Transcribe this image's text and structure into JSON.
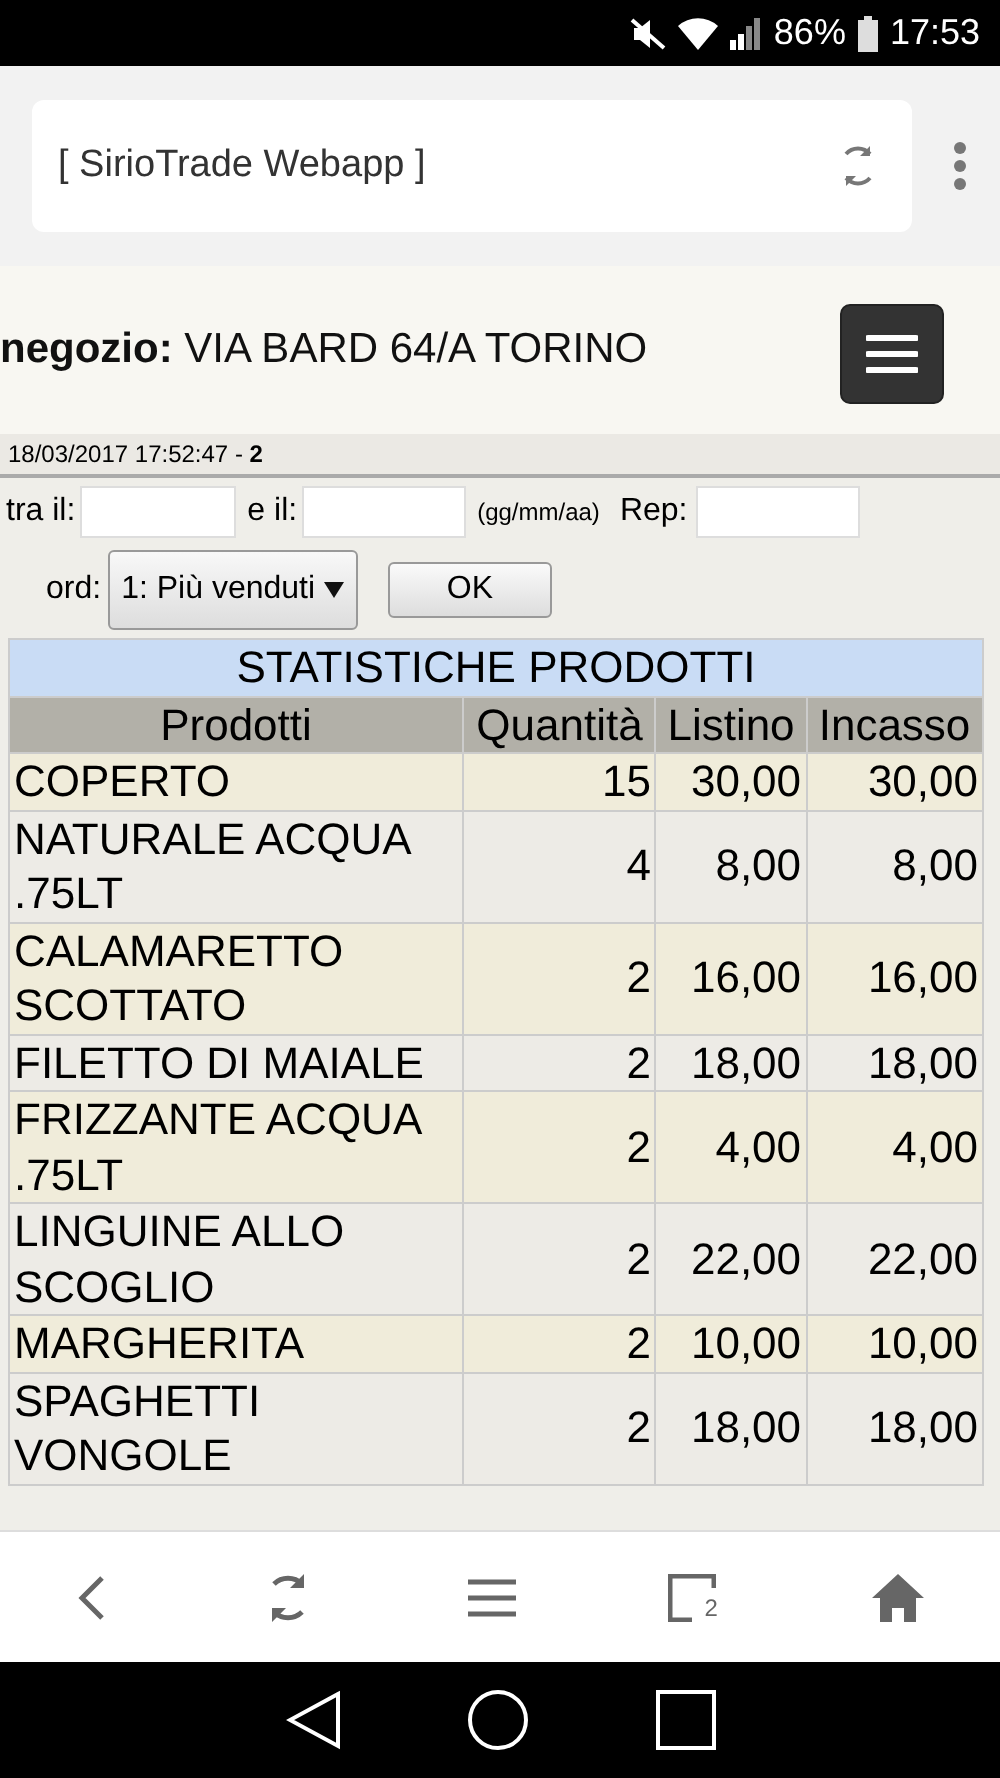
{
  "status_bar": {
    "battery": "86%",
    "time": "17:53"
  },
  "browser": {
    "title": "[ SirioTrade Webapp ]",
    "tab_count": "2"
  },
  "header": {
    "label": "negozio:",
    "store": "VIA BARD 64/A TORINO"
  },
  "timestamp": "18/03/2017 17:52:47 - **2**",
  "filters": {
    "from_label": "tra il:",
    "to_label": "e il:",
    "format_hint": "(gg/mm/aa)",
    "rep_label": "Rep:",
    "order_label": "ord:",
    "order_value": "1: Più venduti",
    "ok": "OK"
  },
  "table": {
    "title": "STATISTICHE PRODOTTI",
    "columns": [
      "Prodotti",
      "Quantità",
      "Listino",
      "Incasso"
    ],
    "rows": [
      [
        "COPERTO",
        "15",
        "30,00",
        "30,00"
      ],
      [
        "NATURALE ACQUA .75LT",
        "4",
        "8,00",
        "8,00"
      ],
      [
        "CALAMARETTO SCOTTATO",
        "2",
        "16,00",
        "16,00"
      ],
      [
        "FILETTO DI MAIALE",
        "2",
        "18,00",
        "18,00"
      ],
      [
        "FRIZZANTE ACQUA .75LT",
        "2",
        "4,00",
        "4,00"
      ],
      [
        "LINGUINE ALLO SCOGLIO",
        "2",
        "22,00",
        "22,00"
      ],
      [
        "MARGHERITA",
        "2",
        "10,00",
        "10,00"
      ],
      [
        "SPAGHETTI VONGOLE",
        "2",
        "18,00",
        "18,00"
      ]
    ]
  }
}
